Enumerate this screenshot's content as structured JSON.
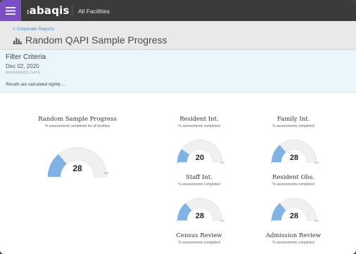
{
  "topbar": {
    "logo": "abaqis",
    "facilities": "All Facilities"
  },
  "header": {
    "breadcrumb": "< Corporate Reports",
    "title": "Random QAPI Sample Progress"
  },
  "filter": {
    "heading": "Filter Criteria",
    "date": "Dec 02, 2020",
    "date_label": "REFERENCE DATE",
    "note": "Results are calculated nightly ..."
  },
  "gauges": [
    {
      "title": "Random Sample Progress",
      "subtitle": "% assessments completed for all facilities",
      "value": 28,
      "min": "0",
      "max": "100"
    },
    {
      "title": "Resident Int.",
      "subtitle": "% assessments completed",
      "value": 20,
      "min": "0",
      "max": "100"
    },
    {
      "title": "Family Int.",
      "subtitle": "% assessments completed",
      "value": 28,
      "min": "0",
      "max": "100"
    },
    {
      "title": "Staff Int.",
      "subtitle": "% assessments completed",
      "value": 28,
      "min": "0",
      "max": "100"
    },
    {
      "title": "Resident Obs.",
      "subtitle": "% assessments completed",
      "value": 28,
      "min": "0",
      "max": "100"
    },
    {
      "title": "Census Review",
      "subtitle": "% assessments completed"
    },
    {
      "title": "Admission Review",
      "subtitle": "% assessments completed"
    }
  ],
  "colors": {
    "menu": "#7c4fc4",
    "gauge_fill": "#7fb3e6",
    "gauge_track": "#f0f0f0"
  }
}
